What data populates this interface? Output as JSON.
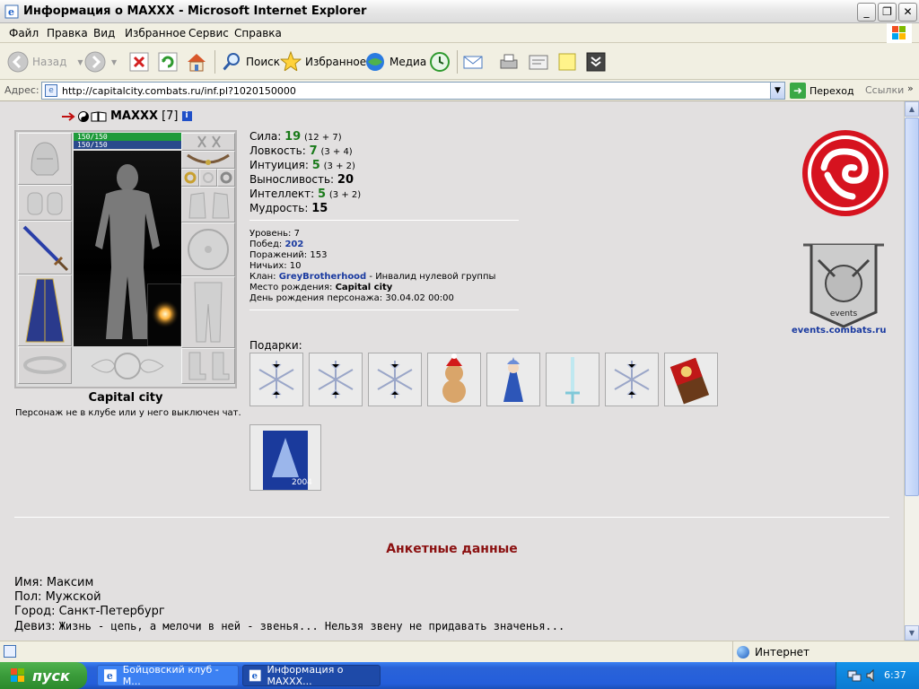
{
  "window": {
    "title": "Информация о MAXXX - Microsoft Internet Explorer",
    "min_glyph": "_",
    "max_glyph": "❐",
    "close_glyph": "✕"
  },
  "menu": [
    "Файл",
    "Правка",
    "Вид",
    "Избранное",
    "Сервис",
    "Справка"
  ],
  "toolbar": {
    "back": "Назад",
    "search": "Поиск",
    "favorites": "Избранное",
    "media": "Медиа"
  },
  "address": {
    "label": "Адрес:",
    "url": "http://capitalcity.combats.ru/inf.pl?1020150000",
    "go": "Переход",
    "links": "Ссылки"
  },
  "character": {
    "name": "MAXXX",
    "level": "[7]",
    "hp": "150/150",
    "mana": "150/150",
    "city": "Capital city",
    "club_note": "Персонаж не в клубе или у него выключен чат."
  },
  "stats": [
    {
      "label": "Сила:",
      "value": "19",
      "extra": "(12 + 7)",
      "color": "#1a7a1a"
    },
    {
      "label": "Ловкость:",
      "value": "7",
      "extra": "(3 + 4)",
      "color": "#1a7a1a"
    },
    {
      "label": "Интуиция:",
      "value": "5",
      "extra": "(3 + 2)",
      "color": "#1a7a1a"
    },
    {
      "label": "Выносливость:",
      "value": "20",
      "extra": "",
      "color": "#000000"
    },
    {
      "label": "Интеллект:",
      "value": "5",
      "extra": "(3 + 2)",
      "color": "#1a7a1a"
    },
    {
      "label": "Мудрость:",
      "value": "15",
      "extra": "",
      "color": "#000000"
    }
  ],
  "info": {
    "level_label": "Уровень:",
    "level": "7",
    "wins_label": "Побед:",
    "wins": "202",
    "losses_label": "Поражений:",
    "losses": "153",
    "draws_label": "Ничьих:",
    "draws": "10",
    "clan_label": "Клан:",
    "clan": "GreyBrotherhood",
    "clan_desc": "- Инвалид нулевой группы",
    "birthplace_label": "Место рождения:",
    "birthplace": "Capital city",
    "birthday_label": "День рождения персонажа:",
    "birthday": "30.04.02 00:00"
  },
  "gifts": {
    "label": "Подарки:",
    "items": [
      "snowflake",
      "snowflake",
      "snowflake",
      "teddy-bear",
      "snow-maiden",
      "ice-sword",
      "snowflake",
      "chocolate",
      "christmas-card"
    ]
  },
  "events_link": "events.combats.ru",
  "events_logo_text": "events",
  "profile": {
    "title": "Анкетные данные",
    "name_label": "Имя:",
    "name": "Максим",
    "sex_label": "Пол:",
    "sex": "Мужской",
    "city_label": "Город:",
    "city": "Санкт-Петербург",
    "motto_label": "Девиз:",
    "motto": "Жизнь - цепь, а мелочи в ней - звенья... Нельзя звену не придавать значенья..."
  },
  "status": {
    "zone": "Интернет"
  },
  "taskbar": {
    "start": "пуск",
    "tasks": [
      "Бойцовский клуб - М...",
      "Информация о MAXXX..."
    ],
    "clock": "6:37"
  },
  "colors": {
    "accent_red": "#d6131f",
    "link_blue": "#1a3aa0",
    "stat_green": "#1a7a1a",
    "profile_title": "#8b1010"
  }
}
